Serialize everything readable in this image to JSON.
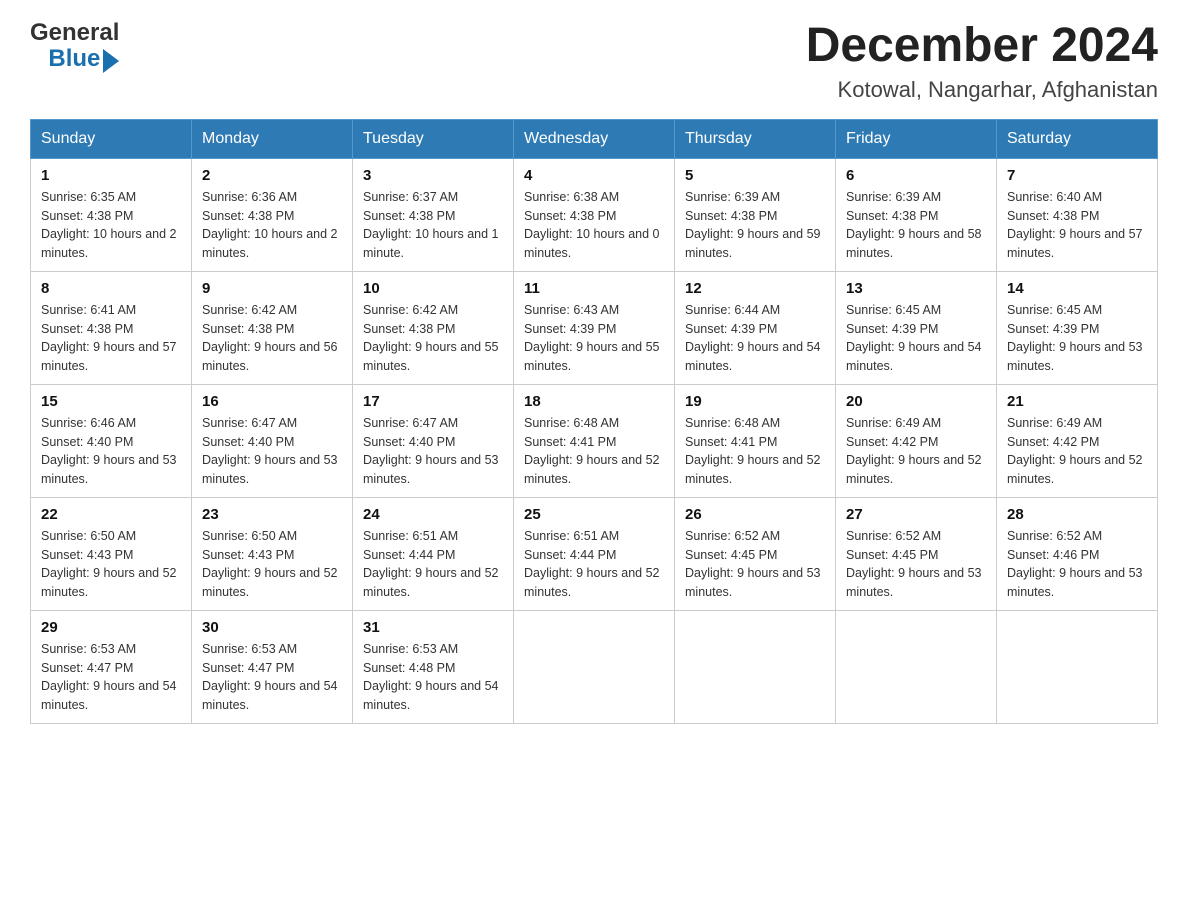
{
  "header": {
    "logo": {
      "text_general": "General",
      "text_blue": "Blue",
      "arrow_label": "logo-arrow"
    },
    "month_title": "December 2024",
    "location": "Kotowal, Nangarhar, Afghanistan"
  },
  "days_of_week": [
    "Sunday",
    "Monday",
    "Tuesday",
    "Wednesday",
    "Thursday",
    "Friday",
    "Saturday"
  ],
  "weeks": [
    [
      {
        "day": "1",
        "sunrise": "6:35 AM",
        "sunset": "4:38 PM",
        "daylight": "10 hours and 2 minutes."
      },
      {
        "day": "2",
        "sunrise": "6:36 AM",
        "sunset": "4:38 PM",
        "daylight": "10 hours and 2 minutes."
      },
      {
        "day": "3",
        "sunrise": "6:37 AM",
        "sunset": "4:38 PM",
        "daylight": "10 hours and 1 minute."
      },
      {
        "day": "4",
        "sunrise": "6:38 AM",
        "sunset": "4:38 PM",
        "daylight": "10 hours and 0 minutes."
      },
      {
        "day": "5",
        "sunrise": "6:39 AM",
        "sunset": "4:38 PM",
        "daylight": "9 hours and 59 minutes."
      },
      {
        "day": "6",
        "sunrise": "6:39 AM",
        "sunset": "4:38 PM",
        "daylight": "9 hours and 58 minutes."
      },
      {
        "day": "7",
        "sunrise": "6:40 AM",
        "sunset": "4:38 PM",
        "daylight": "9 hours and 57 minutes."
      }
    ],
    [
      {
        "day": "8",
        "sunrise": "6:41 AM",
        "sunset": "4:38 PM",
        "daylight": "9 hours and 57 minutes."
      },
      {
        "day": "9",
        "sunrise": "6:42 AM",
        "sunset": "4:38 PM",
        "daylight": "9 hours and 56 minutes."
      },
      {
        "day": "10",
        "sunrise": "6:42 AM",
        "sunset": "4:38 PM",
        "daylight": "9 hours and 55 minutes."
      },
      {
        "day": "11",
        "sunrise": "6:43 AM",
        "sunset": "4:39 PM",
        "daylight": "9 hours and 55 minutes."
      },
      {
        "day": "12",
        "sunrise": "6:44 AM",
        "sunset": "4:39 PM",
        "daylight": "9 hours and 54 minutes."
      },
      {
        "day": "13",
        "sunrise": "6:45 AM",
        "sunset": "4:39 PM",
        "daylight": "9 hours and 54 minutes."
      },
      {
        "day": "14",
        "sunrise": "6:45 AM",
        "sunset": "4:39 PM",
        "daylight": "9 hours and 53 minutes."
      }
    ],
    [
      {
        "day": "15",
        "sunrise": "6:46 AM",
        "sunset": "4:40 PM",
        "daylight": "9 hours and 53 minutes."
      },
      {
        "day": "16",
        "sunrise": "6:47 AM",
        "sunset": "4:40 PM",
        "daylight": "9 hours and 53 minutes."
      },
      {
        "day": "17",
        "sunrise": "6:47 AM",
        "sunset": "4:40 PM",
        "daylight": "9 hours and 53 minutes."
      },
      {
        "day": "18",
        "sunrise": "6:48 AM",
        "sunset": "4:41 PM",
        "daylight": "9 hours and 52 minutes."
      },
      {
        "day": "19",
        "sunrise": "6:48 AM",
        "sunset": "4:41 PM",
        "daylight": "9 hours and 52 minutes."
      },
      {
        "day": "20",
        "sunrise": "6:49 AM",
        "sunset": "4:42 PM",
        "daylight": "9 hours and 52 minutes."
      },
      {
        "day": "21",
        "sunrise": "6:49 AM",
        "sunset": "4:42 PM",
        "daylight": "9 hours and 52 minutes."
      }
    ],
    [
      {
        "day": "22",
        "sunrise": "6:50 AM",
        "sunset": "4:43 PM",
        "daylight": "9 hours and 52 minutes."
      },
      {
        "day": "23",
        "sunrise": "6:50 AM",
        "sunset": "4:43 PM",
        "daylight": "9 hours and 52 minutes."
      },
      {
        "day": "24",
        "sunrise": "6:51 AM",
        "sunset": "4:44 PM",
        "daylight": "9 hours and 52 minutes."
      },
      {
        "day": "25",
        "sunrise": "6:51 AM",
        "sunset": "4:44 PM",
        "daylight": "9 hours and 52 minutes."
      },
      {
        "day": "26",
        "sunrise": "6:52 AM",
        "sunset": "4:45 PM",
        "daylight": "9 hours and 53 minutes."
      },
      {
        "day": "27",
        "sunrise": "6:52 AM",
        "sunset": "4:45 PM",
        "daylight": "9 hours and 53 minutes."
      },
      {
        "day": "28",
        "sunrise": "6:52 AM",
        "sunset": "4:46 PM",
        "daylight": "9 hours and 53 minutes."
      }
    ],
    [
      {
        "day": "29",
        "sunrise": "6:53 AM",
        "sunset": "4:47 PM",
        "daylight": "9 hours and 54 minutes."
      },
      {
        "day": "30",
        "sunrise": "6:53 AM",
        "sunset": "4:47 PM",
        "daylight": "9 hours and 54 minutes."
      },
      {
        "day": "31",
        "sunrise": "6:53 AM",
        "sunset": "4:48 PM",
        "daylight": "9 hours and 54 minutes."
      },
      null,
      null,
      null,
      null
    ]
  ]
}
